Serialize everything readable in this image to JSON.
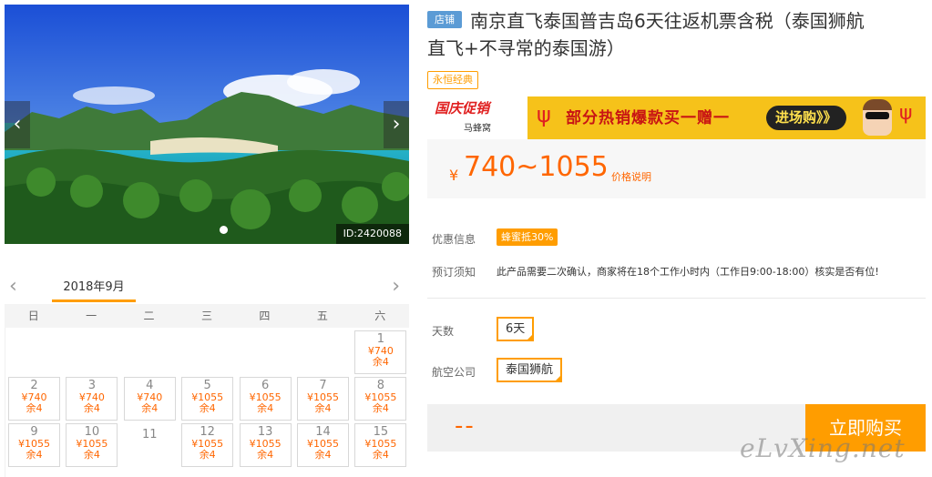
{
  "carousel": {
    "photo_id": "ID:2420088",
    "prev_icon": "chevron-left-icon",
    "next_icon": "chevron-right-icon"
  },
  "calendar": {
    "month_label": "2018年9月",
    "weekdays": [
      "日",
      "一",
      "二",
      "三",
      "四",
      "五",
      "六"
    ],
    "days": [
      {
        "day": "1",
        "price": "¥740",
        "remaining": "余4"
      },
      {
        "day": "2",
        "price": "¥740",
        "remaining": "余4"
      },
      {
        "day": "3",
        "price": "¥740",
        "remaining": "余4"
      },
      {
        "day": "4",
        "price": "¥740",
        "remaining": "余4"
      },
      {
        "day": "5",
        "price": "¥1055",
        "remaining": "余4"
      },
      {
        "day": "6",
        "price": "¥1055",
        "remaining": "余4"
      },
      {
        "day": "7",
        "price": "¥1055",
        "remaining": "余4"
      },
      {
        "day": "8",
        "price": "¥1055",
        "remaining": "余4"
      },
      {
        "day": "9",
        "price": "¥1055",
        "remaining": "余4"
      },
      {
        "day": "10",
        "price": "¥1055",
        "remaining": "余4"
      },
      {
        "day": "11",
        "price": "",
        "remaining": ""
      },
      {
        "day": "12",
        "price": "¥1055",
        "remaining": "余4"
      },
      {
        "day": "13",
        "price": "¥1055",
        "remaining": "余4"
      },
      {
        "day": "14",
        "price": "¥1055",
        "remaining": "余4"
      },
      {
        "day": "15",
        "price": "¥1055",
        "remaining": "余4"
      }
    ]
  },
  "product": {
    "shop_tag": "店铺",
    "title_line1": "南京直飞泰国普吉岛6天往返机票含税（泰国狮航",
    "title_line2": "直飞+不寻常的泰国游）",
    "classic_tag": "永恒经典"
  },
  "promo": {
    "badge_title": "国庆促销",
    "badge_sub": "马蜂窝",
    "text": "部分热销爆款买一赠一",
    "go_label": "进场购》》"
  },
  "price": {
    "currency": "¥",
    "range": "740~1055",
    "note": "价格说明"
  },
  "info": {
    "discount_label": "优惠信息",
    "discount_value": "蜂蜜抵30%",
    "notice_label": "预订须知",
    "notice_value": "此产品需要二次确认，商家将在18个工作小时内（工作日9:00-18:00）核实是否有位!"
  },
  "options": {
    "days_label": "天数",
    "days_value": "6天",
    "airline_label": "航空公司",
    "airline_value": "泰国狮航"
  },
  "buy": {
    "total": "--",
    "button_label": "立即购买"
  },
  "watermark": "eLvXing.net"
}
